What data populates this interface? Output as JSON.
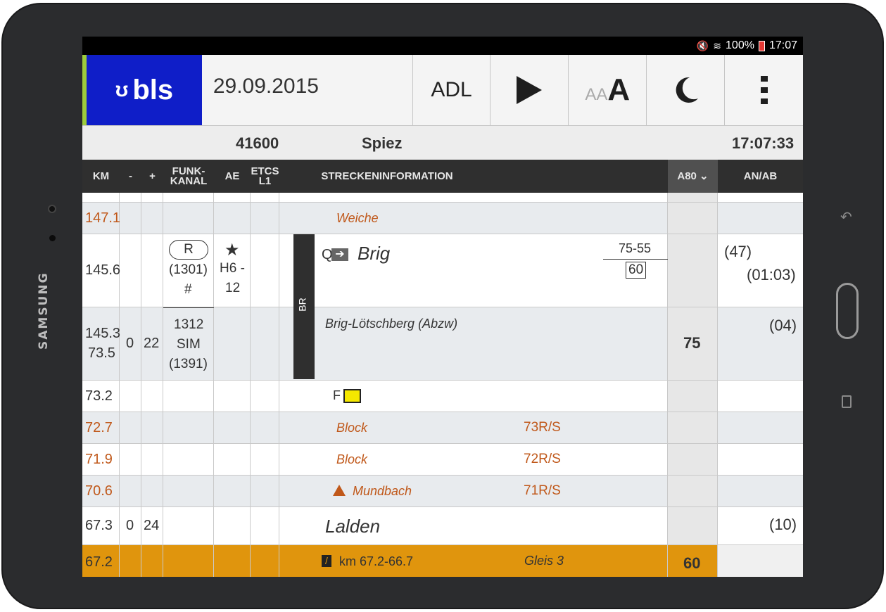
{
  "device": {
    "brand": "SAMSUNG"
  },
  "status_bar": {
    "battery": "100%",
    "time": "17:07"
  },
  "header": {
    "logo_text": "bls",
    "date": "29.09.2015",
    "adl_label": "ADL",
    "font_small": "AA",
    "font_large": "A"
  },
  "info_bar": {
    "train_number": "41600",
    "station": "Spiez",
    "clock": "17:07:33"
  },
  "columns": {
    "km": "KM",
    "minus": "-",
    "plus": "+",
    "funk": "FUNK-KANAL",
    "ae": "AE",
    "etcs": "ETCS L1",
    "strecke": "STRECKENINFORMATION",
    "speed": "A80",
    "anab": "AN/AB"
  },
  "rows": [
    {
      "km": "147.1",
      "strecke": "Weiche"
    },
    {
      "km": "145.6",
      "funk_pill": "R",
      "funk_sub": "(1301)",
      "funk_sub2": "#",
      "ae_line1": "H6 -",
      "ae_line2": "12",
      "q_label": "Q",
      "station": "Brig",
      "speed_top": "75-55",
      "speed_box": "60",
      "an": "(47)",
      "ab": "(01:03)"
    },
    {
      "km": "145.3",
      "km2": "73.5",
      "minus": "0",
      "plus": "22",
      "funk1": "1312",
      "funk2": "SIM",
      "funk3": "(1391)",
      "strecke": "Brig-Lötschberg (Abzw)",
      "speed": "75",
      "anab": "(04)"
    },
    {
      "km": "73.2",
      "strecke": "F"
    },
    {
      "km": "72.7",
      "strecke": "Block",
      "signal": "73R/S"
    },
    {
      "km": "71.9",
      "strecke": "Block",
      "signal": "72R/S"
    },
    {
      "km": "70.6",
      "strecke": "Mundbach",
      "signal": "71R/S"
    },
    {
      "km": "67.3",
      "minus": "0",
      "plus": "24",
      "station": "Lalden",
      "anab": "(10)"
    },
    {
      "km": "67.2",
      "strecke": "km 67.2-66.7",
      "track": "Gleis 3",
      "speed": "60"
    }
  ],
  "br_bar": "BR",
  "colors": {
    "logo_blue": "#0f1ec8",
    "accent_green": "#9ccc3c",
    "highlight_orange": "#e0950d",
    "info_orange": "#c0581a"
  }
}
